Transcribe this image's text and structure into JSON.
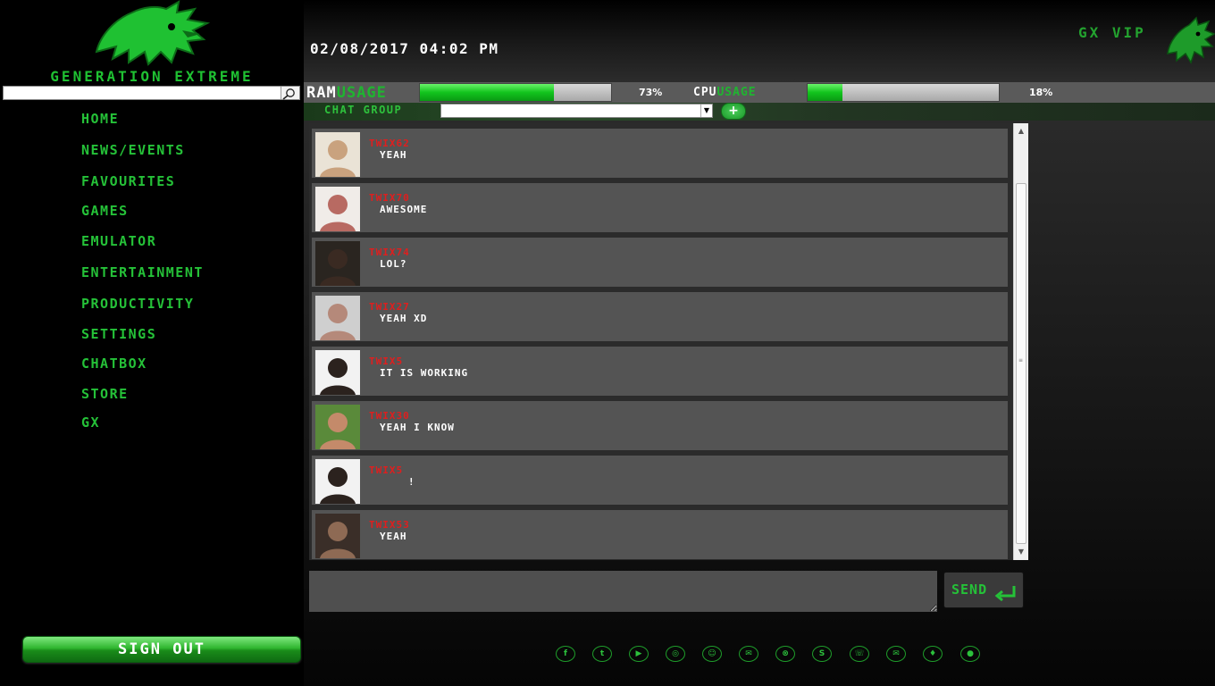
{
  "brand": {
    "name": "GENERATION EXTREME"
  },
  "search": {
    "placeholder": ""
  },
  "nav": [
    {
      "label": "HOME"
    },
    {
      "label": "NEWS/EVENTS"
    },
    {
      "label": "FAVOURITES"
    },
    {
      "label": "GAMES"
    },
    {
      "label": "EMULATOR"
    },
    {
      "label": "ENTERTAINMENT"
    },
    {
      "label": "PRODUCTIVITY"
    },
    {
      "label": "SETTINGS"
    },
    {
      "label": "CHATBOX"
    },
    {
      "label": "STORE"
    },
    {
      "label": "GX"
    }
  ],
  "sign_out": {
    "label": "SIGN OUT"
  },
  "header": {
    "datetime": "02/08/2017 04:02 PM",
    "vip_label": "GX VIP"
  },
  "usage": {
    "ram": {
      "title_a": "RAM",
      "title_b": "USAGE",
      "percent_label": "73%",
      "level": 0.7
    },
    "cpu": {
      "title_a": "CPU",
      "title_b": "USAGE",
      "percent_label": "18%",
      "level": 0.18
    }
  },
  "chat_group": {
    "label": "CHAT GROUP",
    "selected": "",
    "add_label": "+"
  },
  "messages": [
    {
      "user": "TWIX62",
      "text": "YEAH",
      "avatar_color": "#c9a27e"
    },
    {
      "user": "TWIX70",
      "text": "AWESOME",
      "avatar_color": "#b86a62"
    },
    {
      "user": "TWIX74",
      "text": "LOL?",
      "avatar_color": "#3a2a22"
    },
    {
      "user": "TWIX27",
      "text": "YEAH XD",
      "avatar_color": "#b5897a"
    },
    {
      "user": "TWIX5",
      "text": "IT IS WORKING",
      "avatar_color": "#2b221e"
    },
    {
      "user": "TWIX30",
      "text": "YEAH I KNOW",
      "avatar_color": "#c48a6a"
    },
    {
      "user": "TWIX5",
      "text": "!",
      "avatar_color": "#2b221e"
    },
    {
      "user": "TWIX53",
      "text": "YEAH",
      "avatar_color": "#8e6a54"
    }
  ],
  "compose": {
    "placeholder": ""
  },
  "send": {
    "label": "SEND"
  },
  "social": [
    {
      "icon": "facebook-icon",
      "glyph": "f"
    },
    {
      "icon": "twitter-icon",
      "glyph": "t"
    },
    {
      "icon": "youtube-icon",
      "glyph": "▶"
    },
    {
      "icon": "instagram-icon",
      "glyph": "◎"
    },
    {
      "icon": "snapchat-icon",
      "glyph": "☺"
    },
    {
      "icon": "messenger-icon",
      "glyph": "✉"
    },
    {
      "icon": "xbox-icon",
      "glyph": "⊗"
    },
    {
      "icon": "skype-icon",
      "glyph": "S"
    },
    {
      "icon": "phone-icon",
      "glyph": "☏"
    },
    {
      "icon": "mail-icon",
      "glyph": "✉"
    },
    {
      "icon": "android-icon",
      "glyph": "♦"
    },
    {
      "icon": "apple-icon",
      "glyph": "●"
    }
  ],
  "colors": {
    "accent": "#25c138",
    "username": "#e01e1e",
    "message_bg": "#545454"
  }
}
